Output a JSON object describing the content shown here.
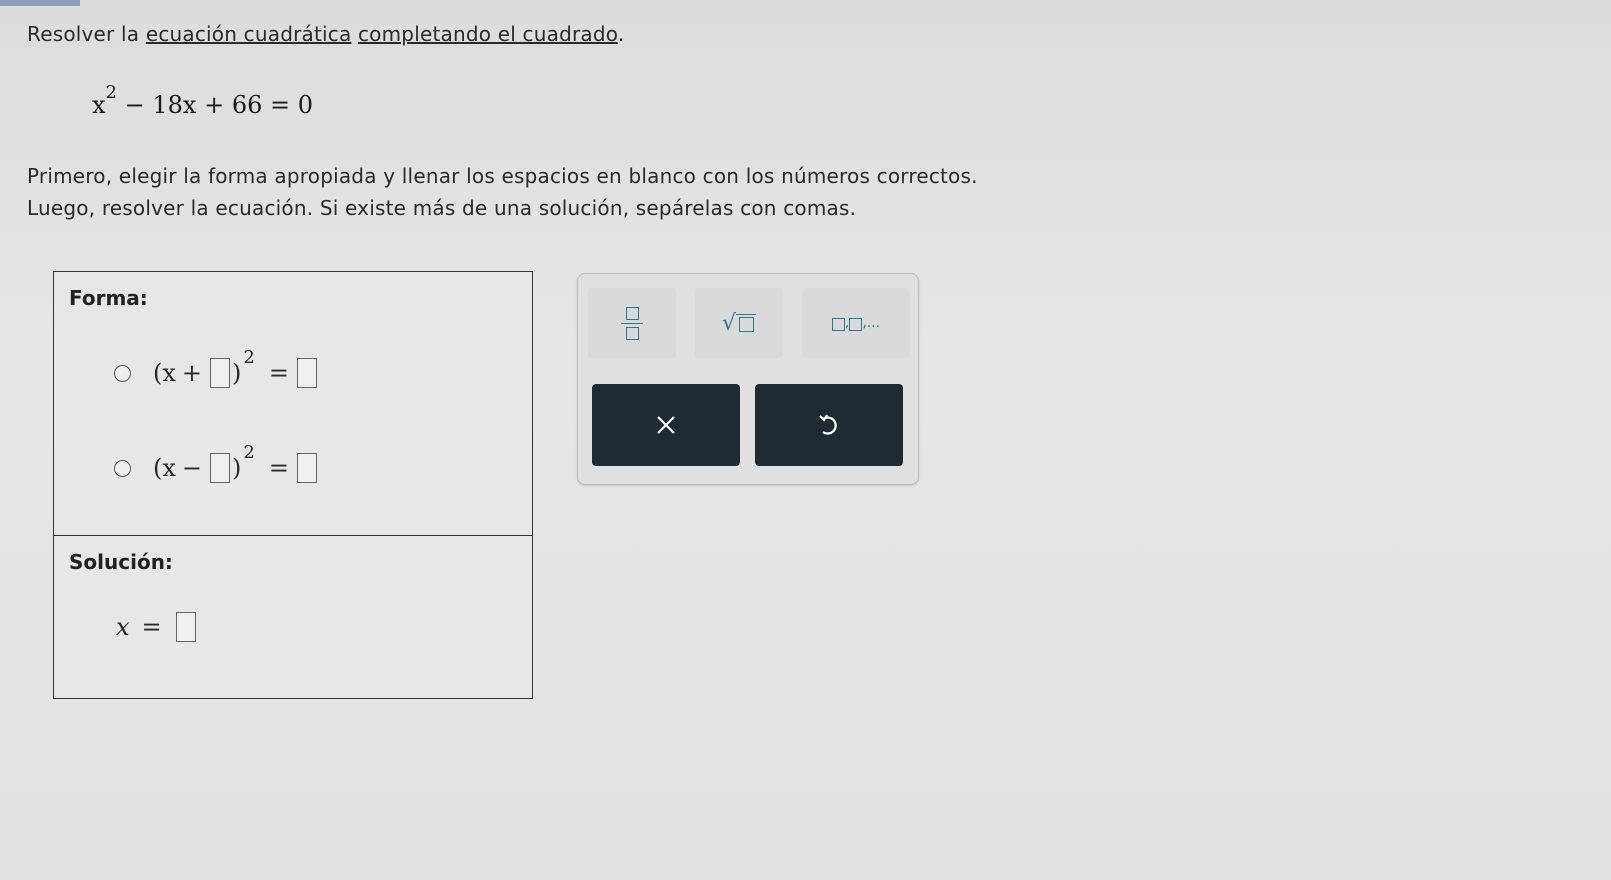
{
  "instructions": {
    "line1_prefix": "Resolver la ",
    "line1_link": "ecuación cuadrática",
    "line1_middle": " ",
    "line1_link2": "completando el cuadrado",
    "line1_suffix": ".",
    "line2": "Primero, elegir la forma apropiada y llenar los espacios en blanco con los números correctos.",
    "line3": "Luego, resolver la ecuación. Si existe más de una solución, sepárelas con comas."
  },
  "equation": {
    "base": "x",
    "exponent": "2",
    "rest": "− 18x + 66 = 0"
  },
  "form_panel": {
    "heading": "Forma:",
    "options": [
      {
        "open": "(x",
        "op": "+",
        "close": ")",
        "exponent": "2",
        "eq": "=",
        "selected": false
      },
      {
        "open": "(x",
        "op": "−",
        "close": ")",
        "exponent": "2",
        "eq": "=",
        "selected": false
      }
    ]
  },
  "solution_panel": {
    "heading": "Solución:",
    "variable": "x",
    "eq": "="
  },
  "toolbar": {
    "list_separator": ",",
    "list_ellipsis": "...",
    "clear_symbol": "×",
    "undo_symbol": "↺"
  },
  "colors": {
    "accent": "#2e7a8c",
    "action_button_bg": "#1f2a33",
    "background": "#e4e4e4"
  }
}
